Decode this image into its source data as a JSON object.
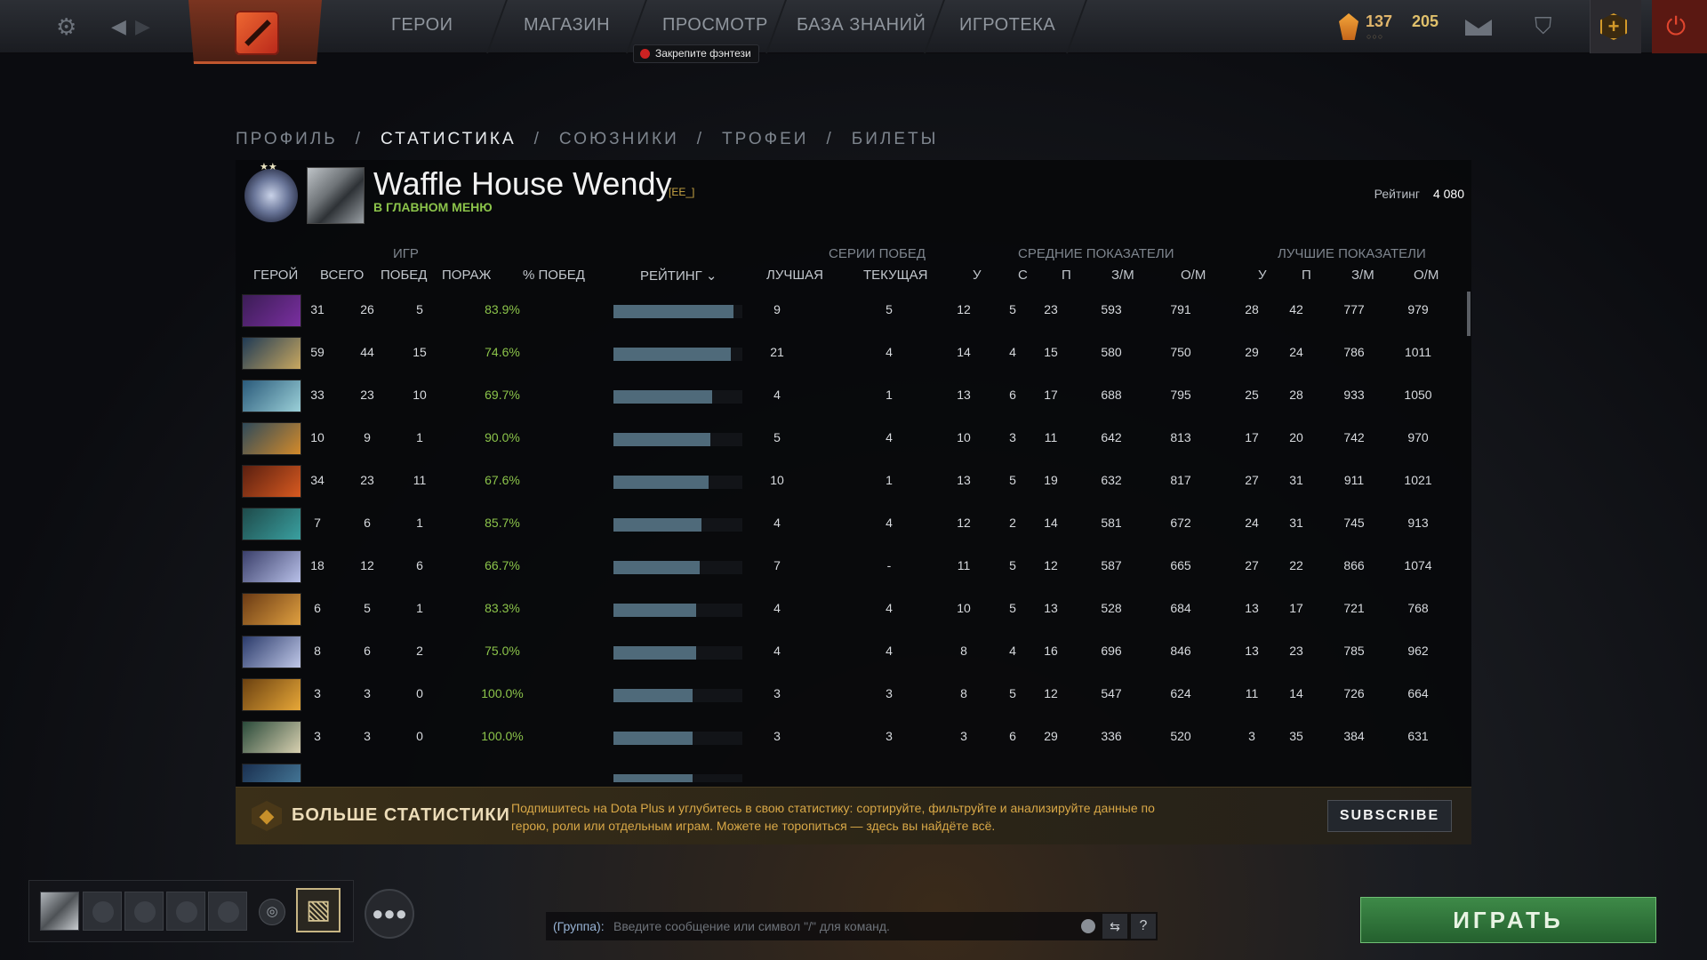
{
  "topbar": {
    "nav": [
      "ГЕРОИ",
      "МАГАЗИН",
      "ПРОСМОТР",
      "БАЗА ЗНАНИЙ",
      "ИГРОТЕКА"
    ],
    "pin_badge": "Закрепите фэнтези",
    "shards": "137",
    "gold": "205",
    "shards_dots": "○○○"
  },
  "subnav": {
    "items": [
      "ПРОФИЛЬ",
      "СТАТИСТИКА",
      "СОЮЗНИКИ",
      "ТРОФЕИ",
      "БИЛЕТЫ"
    ],
    "separator": "/",
    "active_index": 1
  },
  "profile": {
    "name": "Waffle House Wendy",
    "tag": "[EE_]",
    "status": "В ГЛАВНОМ МЕНЮ",
    "rating_label": "Рейтинг",
    "rating_value": "4 080"
  },
  "table": {
    "groups": {
      "games": "ИГР",
      "streaks": "СЕРИИ ПОБЕД",
      "avg": "СРЕДНИЕ ПОКАЗАТЕЛИ",
      "best": "ЛУЧШИЕ ПОКАЗАТЕЛИ"
    },
    "columns": {
      "hero": "ГЕРОЙ",
      "total": "ВСЕГО",
      "wins": "ПОБЕД",
      "losses": "ПОРАЖ",
      "winrate": "% ПОБЕД",
      "rating": "РЕЙТИНГ",
      "best_streak": "ЛУЧШАЯ",
      "cur_streak": "ТЕКУЩАЯ",
      "avg_k": "У",
      "avg_d": "С",
      "avg_a": "П",
      "avg_xpm": "З/М",
      "avg_gpm": "О/М",
      "best_k": "У",
      "best_a": "П",
      "best_xpm": "З/М",
      "best_gpm": "О/М"
    },
    "rows": [
      {
        "hero_colors": [
          "#3b1d55",
          "#7a2fa0"
        ],
        "total": "31",
        "wins": "26",
        "losses": "5",
        "winrate": "83.9%",
        "rating_fill": 1.0,
        "best_streak": "9",
        "cur_streak": "5",
        "ak": "12",
        "ad": "5",
        "aa": "23",
        "axpm": "593",
        "agpm": "791",
        "bk": "28",
        "ba": "42",
        "bxpm": "777",
        "bgpm": "979"
      },
      {
        "hero_colors": [
          "#1f3a55",
          "#c9a860"
        ],
        "total": "59",
        "wins": "44",
        "losses": "15",
        "winrate": "74.6%",
        "rating_fill": 0.98,
        "best_streak": "21",
        "cur_streak": "4",
        "ak": "14",
        "ad": "4",
        "aa": "15",
        "axpm": "580",
        "agpm": "750",
        "bk": "29",
        "ba": "24",
        "bxpm": "786",
        "bgpm": "1011"
      },
      {
        "hero_colors": [
          "#2a5a7a",
          "#9bd0d8"
        ],
        "total": "33",
        "wins": "23",
        "losses": "10",
        "winrate": "69.7%",
        "rating_fill": 0.82,
        "best_streak": "4",
        "cur_streak": "1",
        "ak": "13",
        "ad": "6",
        "aa": "17",
        "axpm": "688",
        "agpm": "795",
        "bk": "25",
        "ba": "28",
        "bxpm": "933",
        "bgpm": "1050"
      },
      {
        "hero_colors": [
          "#2f4a5a",
          "#d38a2a"
        ],
        "total": "10",
        "wins": "9",
        "losses": "1",
        "winrate": "90.0%",
        "rating_fill": 0.81,
        "best_streak": "5",
        "cur_streak": "4",
        "ak": "10",
        "ad": "3",
        "aa": "11",
        "axpm": "642",
        "agpm": "813",
        "bk": "17",
        "ba": "20",
        "bxpm": "742",
        "bgpm": "970"
      },
      {
        "hero_colors": [
          "#5a1f10",
          "#d85a20"
        ],
        "total": "34",
        "wins": "23",
        "losses": "11",
        "winrate": "67.6%",
        "rating_fill": 0.79,
        "best_streak": "10",
        "cur_streak": "1",
        "ak": "13",
        "ad": "5",
        "aa": "19",
        "axpm": "632",
        "agpm": "817",
        "bk": "27",
        "ba": "31",
        "bxpm": "911",
        "bgpm": "1021"
      },
      {
        "hero_colors": [
          "#1e4a4a",
          "#3aa0a0"
        ],
        "total": "7",
        "wins": "6",
        "losses": "1",
        "winrate": "85.7%",
        "rating_fill": 0.73,
        "best_streak": "4",
        "cur_streak": "4",
        "ak": "12",
        "ad": "2",
        "aa": "14",
        "axpm": "581",
        "agpm": "672",
        "bk": "24",
        "ba": "31",
        "bxpm": "745",
        "bgpm": "913"
      },
      {
        "hero_colors": [
          "#3a3f6a",
          "#b8c0e8"
        ],
        "total": "18",
        "wins": "12",
        "losses": "6",
        "winrate": "66.7%",
        "rating_fill": 0.72,
        "best_streak": "7",
        "cur_streak": "-",
        "ak": "11",
        "ad": "5",
        "aa": "12",
        "axpm": "587",
        "agpm": "665",
        "bk": "27",
        "ba": "22",
        "bxpm": "866",
        "bgpm": "1074"
      },
      {
        "hero_colors": [
          "#6a3a14",
          "#e0a040"
        ],
        "total": "6",
        "wins": "5",
        "losses": "1",
        "winrate": "83.3%",
        "rating_fill": 0.69,
        "best_streak": "4",
        "cur_streak": "4",
        "ak": "10",
        "ad": "5",
        "aa": "13",
        "axpm": "528",
        "agpm": "684",
        "bk": "13",
        "ba": "17",
        "bxpm": "721",
        "bgpm": "768"
      },
      {
        "hero_colors": [
          "#2a3a6a",
          "#c0c8e8"
        ],
        "total": "8",
        "wins": "6",
        "losses": "2",
        "winrate": "75.0%",
        "rating_fill": 0.69,
        "best_streak": "4",
        "cur_streak": "4",
        "ak": "8",
        "ad": "4",
        "aa": "16",
        "axpm": "696",
        "agpm": "846",
        "bk": "13",
        "ba": "23",
        "bxpm": "785",
        "bgpm": "962"
      },
      {
        "hero_colors": [
          "#6a4010",
          "#e8a838"
        ],
        "total": "3",
        "wins": "3",
        "losses": "0",
        "winrate": "100.0%",
        "rating_fill": 0.66,
        "best_streak": "3",
        "cur_streak": "3",
        "ak": "8",
        "ad": "5",
        "aa": "12",
        "axpm": "547",
        "agpm": "624",
        "bk": "11",
        "ba": "14",
        "bxpm": "726",
        "bgpm": "664"
      },
      {
        "hero_colors": [
          "#2a4a3a",
          "#d8d0b0"
        ],
        "total": "3",
        "wins": "3",
        "losses": "0",
        "winrate": "100.0%",
        "rating_fill": 0.66,
        "best_streak": "3",
        "cur_streak": "3",
        "ak": "3",
        "ad": "6",
        "aa": "29",
        "axpm": "336",
        "agpm": "520",
        "bk": "3",
        "ba": "35",
        "bxpm": "384",
        "bgpm": "631"
      },
      {
        "hero_colors": [
          "#1a3050",
          "#4a80a0"
        ],
        "total": "",
        "wins": "",
        "losses": "",
        "winrate": "",
        "rating_fill": 0.66,
        "best_streak": "",
        "cur_streak": "",
        "ak": "",
        "ad": "",
        "aa": "",
        "axpm": "",
        "agpm": "",
        "bk": "",
        "ba": "",
        "bxpm": "",
        "bgpm": ""
      }
    ]
  },
  "banner": {
    "title": "БОЛЬШЕ СТАТИСТИКИ",
    "text": "Подпишитесь на Dota Plus и углубитесь в свою статистику: сортируйте, фильтруйте и анализируйте данные по герою, роли или отдельным играм. Можете не торопиться — здесь вы найдёте всё.",
    "button": "SUBSCRIBE"
  },
  "chat": {
    "channel": "(Группа):",
    "placeholder": "Введите сообщение или символ \"/\" для команд."
  },
  "play_button": "ИГРАТЬ"
}
